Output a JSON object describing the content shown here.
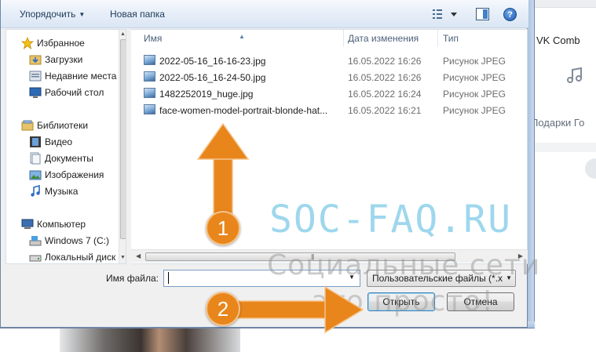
{
  "background": {
    "vk_combo": "VK Comb",
    "gifts": "Подарки  Го"
  },
  "toolbar": {
    "organize_label": "Упорядочить",
    "new_folder_label": "Новая папка",
    "help_label": "?"
  },
  "nav": {
    "items": [
      {
        "label": "Избранное",
        "icon": "star-icon"
      },
      {
        "label": "Загрузки",
        "icon": "downloads-folder-icon"
      },
      {
        "label": "Недавние места",
        "icon": "recent-places-icon"
      },
      {
        "label": "Рабочий стол",
        "icon": "desktop-icon"
      },
      {
        "label": "Библиотеки",
        "icon": "libraries-icon"
      },
      {
        "label": "Видео",
        "icon": "video-library-icon"
      },
      {
        "label": "Документы",
        "icon": "documents-library-icon"
      },
      {
        "label": "Изображения",
        "icon": "pictures-library-icon"
      },
      {
        "label": "Музыка",
        "icon": "music-library-icon"
      },
      {
        "label": "Компьютер",
        "icon": "computer-icon"
      },
      {
        "label": "Windows 7 (C:)",
        "icon": "drive-c-icon"
      },
      {
        "label": "Локальный диск",
        "icon": "local-disk-icon"
      }
    ]
  },
  "filelist": {
    "columns": {
      "name": "Имя",
      "date": "Дата изменения",
      "type": "Тип"
    },
    "files": [
      {
        "name": "2022-05-16_16-16-23.jpg",
        "date": "16.05.2022 16:26",
        "type": "Рисунок JPEG"
      },
      {
        "name": "2022-05-16_16-24-50.jpg",
        "date": "16.05.2022 16:26",
        "type": "Рисунок JPEG"
      },
      {
        "name": "1482252019_huge.jpg",
        "date": "16.05.2022 16:24",
        "type": "Рисунок JPEG"
      },
      {
        "name": "face-women-model-portrait-blonde-hat...",
        "date": "16.05.2022 16:21",
        "type": "Рисунок JPEG"
      }
    ],
    "hscroll_grip": "|||"
  },
  "bottom": {
    "filename_label": "Имя файла:",
    "filename_value": "",
    "filetype_value": "Пользовательские файлы (*.x",
    "open_label": "Открыть",
    "cancel_label": "Отмена"
  },
  "watermark": {
    "main": "SOC-FAQ.RU",
    "sub1": "Социальные сети",
    "sub2": "это просто!"
  },
  "annotations": {
    "step1": "1",
    "step2": "2",
    "arrow_color": "#e8861c"
  }
}
